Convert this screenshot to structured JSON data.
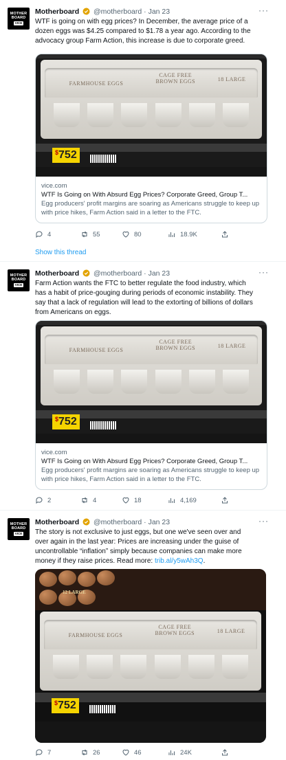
{
  "colors": {
    "link": "#1d9bf0",
    "verified": "#e2a300",
    "muted": "#536471"
  },
  "tweets": [
    {
      "avatar": {
        "line1": "MOTHER\nBOARD",
        "line2": "VICE"
      },
      "name": "Motherboard",
      "handle": "@motherboard",
      "dot": "·",
      "date": "Jan 23",
      "more": "···",
      "text": "WTF is going on with egg prices? In December, the average price of a dozen eggs was $4.25 compared to $1.78 a year ago. According to the advocacy group Farm Action, this increase is due to corporate greed.",
      "card": {
        "photo": {
          "print1": "FARMHOUSE EGGS",
          "print2": "CAGE FREE\nBROWN EGGS",
          "print3": "18 LARGE",
          "price": "752"
        },
        "domain": "vice.com",
        "title": "WTF Is Going on With Absurd Egg Prices? Corporate Greed, Group T...",
        "description": "Egg producers' profit margins are soaring as Americans struggle to keep up with price hikes, Farm Action said in a letter to the FTC."
      },
      "actions": {
        "reply": "4",
        "retweet": "55",
        "like": "80",
        "views": "18.9K"
      }
    },
    {
      "avatar": {
        "line1": "MOTHER\nBOARD",
        "line2": "VICE"
      },
      "name": "Motherboard",
      "handle": "@motherboard",
      "dot": "·",
      "date": "Jan 23",
      "more": "···",
      "text": "Farm Action wants the FTC to better regulate the food industry, which has a habit of price-gouging during periods of economic instability. They say that a lack of regulation will lead to the extorting of billions of dollars from Americans on eggs.",
      "card": {
        "photo": {
          "print1": "FARMHOUSE EGGS",
          "print2": "CAGE FREE\nBROWN EGGS",
          "print3": "18 LARGE",
          "price": "752"
        },
        "domain": "vice.com",
        "title": "WTF Is Going on With Absurd Egg Prices? Corporate Greed, Group T...",
        "description": "Egg producers' profit margins are soaring as Americans struggle to keep up with price hikes, Farm Action said in a letter to the FTC."
      },
      "actions": {
        "reply": "2",
        "retweet": "4",
        "like": "18",
        "views": "4,169"
      }
    },
    {
      "avatar": {
        "line1": "MOTHER\nBOARD",
        "line2": "VICE"
      },
      "name": "Motherboard",
      "handle": "@motherboard",
      "dot": "·",
      "date": "Jan 23",
      "more": "···",
      "text_before_link": "The story is not exclusive to just eggs, but one we've seen over and over again in the last year: Prices are increasing under the guise of uncontrollable “inflation” simply because companies can make more money if they raise prices. Read more: ",
      "link": "trib.al/y5wAh3Q",
      "text_after_link": ".",
      "photo": {
        "print1": "FARMHOUSE EGGS",
        "print2": "CAGE FREE\nBROWN EGGS",
        "print3": "18 LARGE",
        "price": "752",
        "top_sign": "12 LARGE"
      },
      "actions": {
        "reply": "7",
        "retweet": "26",
        "like": "46",
        "views": "24K"
      }
    }
  ],
  "show_thread": "Show this thread"
}
